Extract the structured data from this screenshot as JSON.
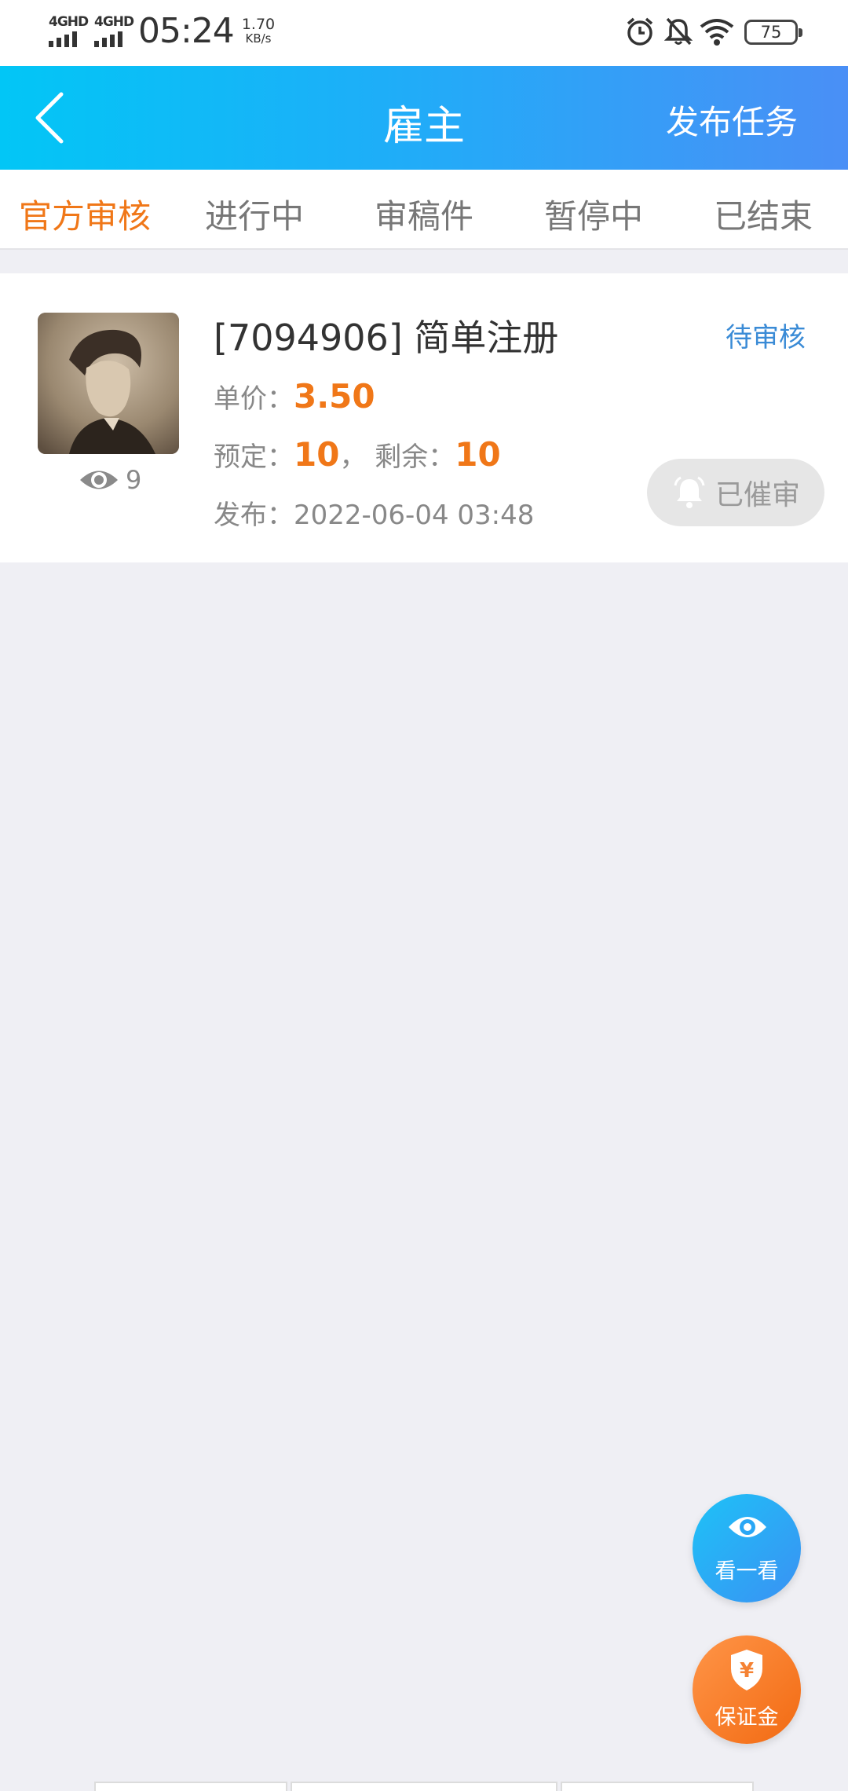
{
  "status_bar": {
    "sim1_label": "4GHD",
    "sim2_label": "4GHD",
    "time": "05:24",
    "speed_value": "1.70",
    "speed_unit": "KB/s",
    "battery": "75"
  },
  "header": {
    "title": "雇主",
    "publish_label": "发布任务"
  },
  "tabs": [
    {
      "label": "官方审核",
      "active": true
    },
    {
      "label": "进行中",
      "active": false
    },
    {
      "label": "审稿件",
      "active": false
    },
    {
      "label": "暂停中",
      "active": false
    },
    {
      "label": "已结束",
      "active": false
    }
  ],
  "task": {
    "title": "[7094906] 简单注册",
    "status": "待审核",
    "views": "9",
    "price_label": "单价：",
    "price": "3.50",
    "reserved_label": "预定：",
    "reserved": "10",
    "separator": "，",
    "remaining_label": "剩余：",
    "remaining": "10",
    "published_label": "发布：",
    "published": "2022-06-04 03:48",
    "urge_label": "已催审"
  },
  "fabs": {
    "look_label": "看一看",
    "deposit_label": "保证金",
    "deposit_symbol": "¥"
  },
  "colors": {
    "accent_orange": "#f07718",
    "status_blue": "#3a8bd6",
    "header_gradient_start": "#02c6f6",
    "header_gradient_end": "#4a8ff6"
  }
}
